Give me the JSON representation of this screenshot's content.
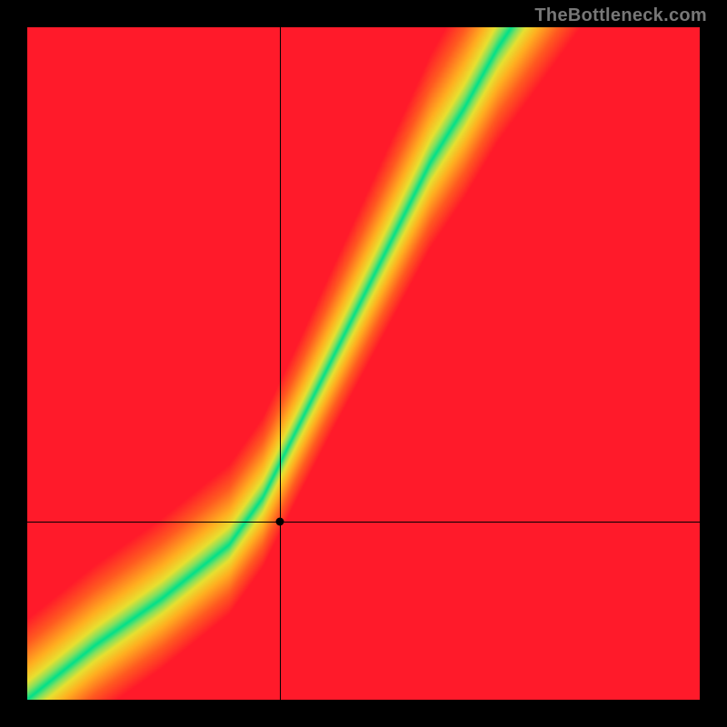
{
  "watermark_text": "TheBottleneck.com",
  "chart_data": {
    "type": "heatmap",
    "title": "",
    "xlabel": "",
    "ylabel": "",
    "x_range": [
      0,
      1
    ],
    "y_range": [
      0,
      1
    ],
    "note": "Color field from red (high bottleneck) through yellow to green (balanced). Green ridge runs roughly along y ≈ f(x) described by ridge_points below (normalized coords, origin bottom-left).",
    "ridge_points": [
      {
        "x": 0.0,
        "y": 0.0
      },
      {
        "x": 0.1,
        "y": 0.08
      },
      {
        "x": 0.2,
        "y": 0.15
      },
      {
        "x": 0.3,
        "y": 0.23
      },
      {
        "x": 0.35,
        "y": 0.3
      },
      {
        "x": 0.4,
        "y": 0.4
      },
      {
        "x": 0.45,
        "y": 0.5
      },
      {
        "x": 0.5,
        "y": 0.6
      },
      {
        "x": 0.55,
        "y": 0.7
      },
      {
        "x": 0.6,
        "y": 0.8
      },
      {
        "x": 0.65,
        "y": 0.88
      },
      {
        "x": 0.7,
        "y": 0.97
      },
      {
        "x": 0.72,
        "y": 1.0
      }
    ],
    "ridge_width": 0.09,
    "crosshair": {
      "x": 0.375,
      "y": 0.265
    },
    "marker": {
      "x": 0.375,
      "y": 0.265
    },
    "color_stops": [
      {
        "t": 0.0,
        "color": "#00e08a"
      },
      {
        "t": 0.1,
        "color": "#7fe060"
      },
      {
        "t": 0.22,
        "color": "#e8e030"
      },
      {
        "t": 0.4,
        "color": "#ffb020"
      },
      {
        "t": 0.7,
        "color": "#ff5a20"
      },
      {
        "t": 1.0,
        "color": "#ff1a2a"
      }
    ]
  }
}
